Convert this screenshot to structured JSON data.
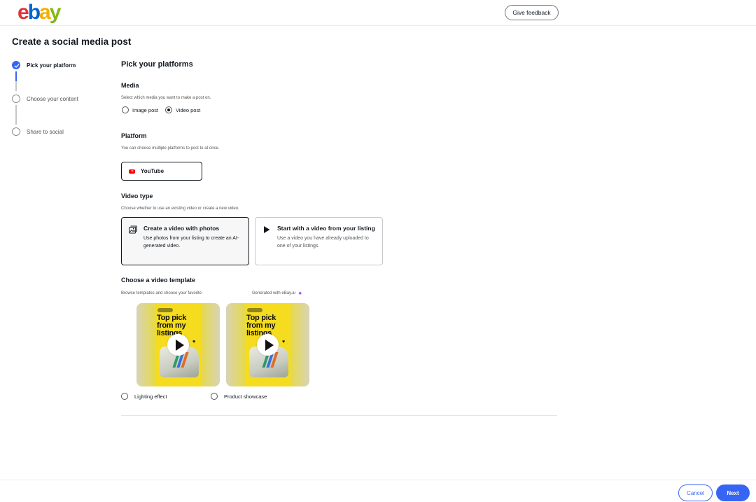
{
  "brand": {
    "logo_letters": [
      "e",
      "b",
      "a",
      "y"
    ],
    "logo_colors": [
      "#e53238",
      "#0064d2",
      "#f5af02",
      "#86b817"
    ],
    "accent_color": "#3665f3"
  },
  "header": {
    "feedback_label": "Give feedback"
  },
  "page": {
    "title": "Create a social media post"
  },
  "steps": [
    {
      "label": "Pick your platform",
      "state": "completed"
    },
    {
      "label": "Choose your content",
      "state": "pending"
    },
    {
      "label": "Share to social",
      "state": "pending"
    }
  ],
  "main": {
    "heading": "Pick your platforms",
    "media": {
      "title": "Media",
      "hint": "Select which media you want to make a post on.",
      "options": [
        {
          "label": "Image post",
          "checked": false
        },
        {
          "label": "Video post",
          "checked": true
        }
      ]
    },
    "platform": {
      "title": "Platform",
      "hint": "You can choose multiple platforms to post to at once.",
      "selected": "YouTube",
      "icon": "youtube-icon"
    },
    "video_type": {
      "title": "Video type",
      "hint": "Choose whether to use an existing video or create a new video.",
      "cards": [
        {
          "title": "Create a video with photos",
          "description": "Use photos from your listing to create an AI-generated video.",
          "icon": "photo-video-icon",
          "selected": true
        },
        {
          "title": "Start with a video from your listing",
          "description": "Use a video you have already uploaded to one of your listings.",
          "icon": "play-icon",
          "selected": false
        }
      ]
    },
    "template": {
      "title": "Choose a video template",
      "hint": "Browse templates and choose your favorite",
      "generated_label": "Generated with eBay.ai",
      "sparkle_icon": "sparkle-icon",
      "poster_headline": "Top pick from my listings",
      "options": [
        {
          "label": "Lighting effect",
          "checked": false
        },
        {
          "label": "Product showcase",
          "checked": false
        }
      ]
    }
  },
  "footer": {
    "cancel_label": "Cancel",
    "next_label": "Next"
  }
}
